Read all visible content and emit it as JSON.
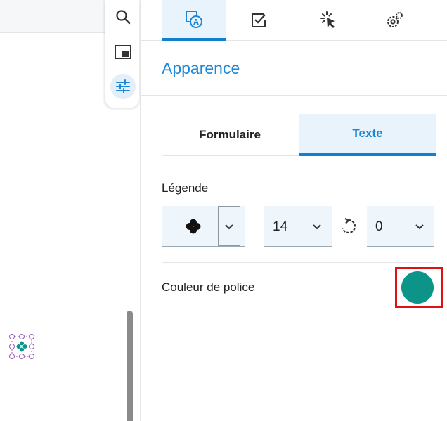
{
  "colors": {
    "accent": "#1b87d6",
    "active_tab_bg": "#e8f3fc",
    "font_color_swatch": "#0d9488",
    "highlight_box": "#e01010"
  },
  "toolstrip": {
    "items": [
      {
        "icon": "search-icon",
        "active": false
      },
      {
        "icon": "panel-icon",
        "active": false
      },
      {
        "icon": "sliders-icon",
        "active": true
      }
    ]
  },
  "top_tabs": [
    {
      "icon": "appearance-icon",
      "active": true
    },
    {
      "icon": "checkbox-icon",
      "active": false
    },
    {
      "icon": "click-icon",
      "active": false
    },
    {
      "icon": "settings-icon",
      "active": false
    }
  ],
  "section": {
    "title": "Apparence"
  },
  "sub_tabs": [
    {
      "label": "Formulaire",
      "active": false
    },
    {
      "label": "Texte",
      "active": true
    }
  ],
  "legend": {
    "label": "Légende",
    "icon_select": {
      "selected_icon": "clover-icon"
    },
    "font_size": {
      "value": "14"
    },
    "rotation": {
      "value": "0"
    }
  },
  "font_color": {
    "label": "Couleur de police",
    "value": "#0d9488"
  }
}
